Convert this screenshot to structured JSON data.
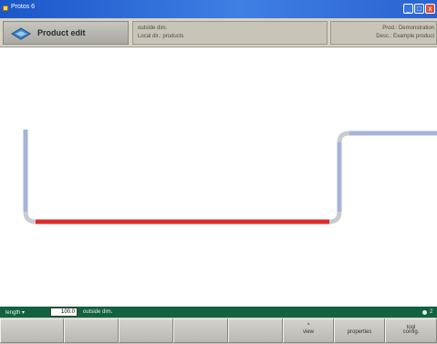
{
  "window": {
    "title": "Protos 6",
    "controls": {
      "minimize": "_",
      "maximize": "□",
      "close": "x"
    }
  },
  "header": {
    "title": "Product edit",
    "icon": "product-edit-icon",
    "middle_line1": "outside dim.",
    "middle_line2": "Local dir.: products",
    "right_line1": "Prod.: Demonstration",
    "right_line2": "Desc.: Example product"
  },
  "status": {
    "param_label": "length ▾",
    "param_value": "100.0",
    "mode": "outside dim.",
    "page_number": "2"
  },
  "softkeys": [
    {
      "label": ""
    },
    {
      "label": ""
    },
    {
      "label": ""
    },
    {
      "label": ""
    },
    {
      "label": ""
    },
    {
      "label": "view"
    },
    {
      "label": "properties"
    },
    {
      "label_line1": "tool",
      "label_line2": "config."
    }
  ],
  "profile_colors": {
    "segment": "#a7b3d8",
    "selected_segment": "#e02b2b",
    "bend": "#c8cbd3"
  }
}
